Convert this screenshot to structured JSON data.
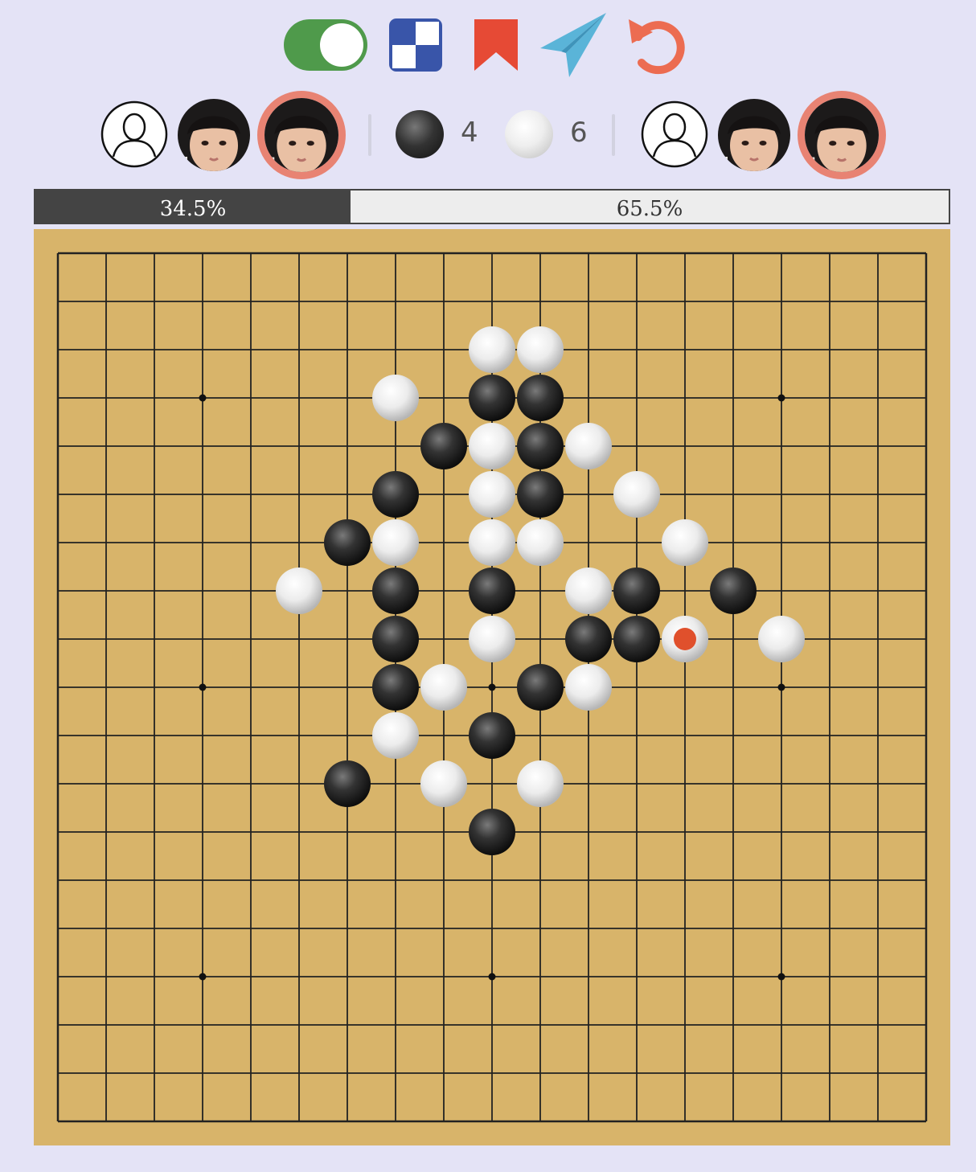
{
  "toolbar": {
    "buttons": [
      {
        "name": "toggle-switch-icon",
        "color": "#4f9a4b"
      },
      {
        "name": "board-pattern-icon",
        "color": "#3955a9"
      },
      {
        "name": "bookmark-icon",
        "color": "#e64a35"
      },
      {
        "name": "send-icon",
        "color": "#5ab4d8"
      },
      {
        "name": "undo-icon",
        "color": "#ec6c51"
      }
    ]
  },
  "score": {
    "black_count": "4",
    "white_count": "6"
  },
  "win_rate": {
    "black": 0.345,
    "white": 0.655,
    "black_label": "34.5%",
    "white_label": "65.5%"
  },
  "board": {
    "size": 19,
    "star_points": [
      [
        3,
        3
      ],
      [
        15,
        3
      ],
      [
        3,
        9
      ],
      [
        9,
        9
      ],
      [
        15,
        9
      ],
      [
        3,
        15
      ],
      [
        9,
        15
      ],
      [
        15,
        15
      ]
    ],
    "black_stones": [
      [
        9,
        3
      ],
      [
        10,
        3
      ],
      [
        8,
        4
      ],
      [
        10,
        4
      ],
      [
        7,
        5
      ],
      [
        10,
        5
      ],
      [
        6,
        6
      ],
      [
        7,
        7
      ],
      [
        9,
        7
      ],
      [
        12,
        7
      ],
      [
        14,
        7
      ],
      [
        7,
        8
      ],
      [
        11,
        8
      ],
      [
        12,
        8
      ],
      [
        7,
        9
      ],
      [
        10,
        9
      ],
      [
        9,
        10
      ],
      [
        6,
        11
      ],
      [
        9,
        12
      ]
    ],
    "white_stones": [
      [
        9,
        2
      ],
      [
        10,
        2
      ],
      [
        7,
        3
      ],
      [
        9,
        4
      ],
      [
        11,
        4
      ],
      [
        9,
        5
      ],
      [
        12,
        5
      ],
      [
        7,
        6
      ],
      [
        9,
        6
      ],
      [
        10,
        6
      ],
      [
        13,
        6
      ],
      [
        5,
        7
      ],
      [
        11,
        7
      ],
      [
        9,
        8
      ],
      [
        13,
        8
      ],
      [
        15,
        8
      ],
      [
        8,
        9
      ],
      [
        11,
        9
      ],
      [
        7,
        10
      ],
      [
        8,
        11
      ],
      [
        10,
        11
      ]
    ],
    "last_move": [
      13,
      8
    ],
    "last_move_color": "#e0502c"
  }
}
